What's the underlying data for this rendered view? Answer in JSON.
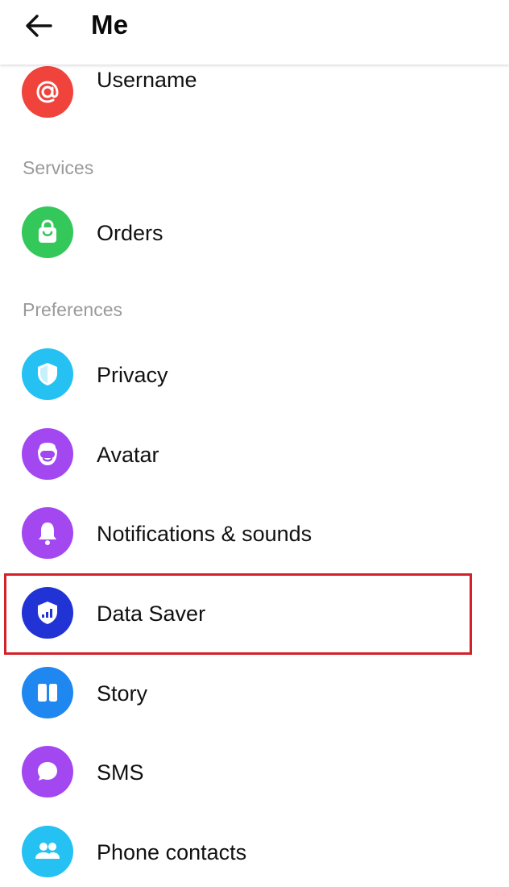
{
  "header": {
    "title": "Me",
    "back_icon": "arrow-left-icon"
  },
  "sections": {
    "services": "Services",
    "preferences": "Preferences"
  },
  "items": [
    {
      "id": "username",
      "label": "Username",
      "icon": "at-sign-icon",
      "color": "#f0433c"
    },
    {
      "id": "orders",
      "label": "Orders",
      "icon": "shopping-bag-icon",
      "color": "#34c759"
    },
    {
      "id": "privacy",
      "label": "Privacy",
      "icon": "shield-icon",
      "color": "#24c1f2"
    },
    {
      "id": "avatar",
      "label": "Avatar",
      "icon": "avatar-face-icon",
      "color": "#a347f0"
    },
    {
      "id": "notifications",
      "label": "Notifications & sounds",
      "icon": "bell-icon",
      "color": "#a347f0"
    },
    {
      "id": "data-saver",
      "label": "Data Saver",
      "icon": "shield-signal-icon",
      "color": "#2233d6"
    },
    {
      "id": "story",
      "label": "Story",
      "icon": "story-cards-icon",
      "color": "#1e88f0"
    },
    {
      "id": "sms",
      "label": "SMS",
      "icon": "chat-bubble-icon",
      "color": "#a347f0"
    },
    {
      "id": "phone-contacts",
      "label": "Phone contacts",
      "icon": "people-icon",
      "color": "#24c1f2"
    }
  ],
  "highlight_color": "#d32029"
}
